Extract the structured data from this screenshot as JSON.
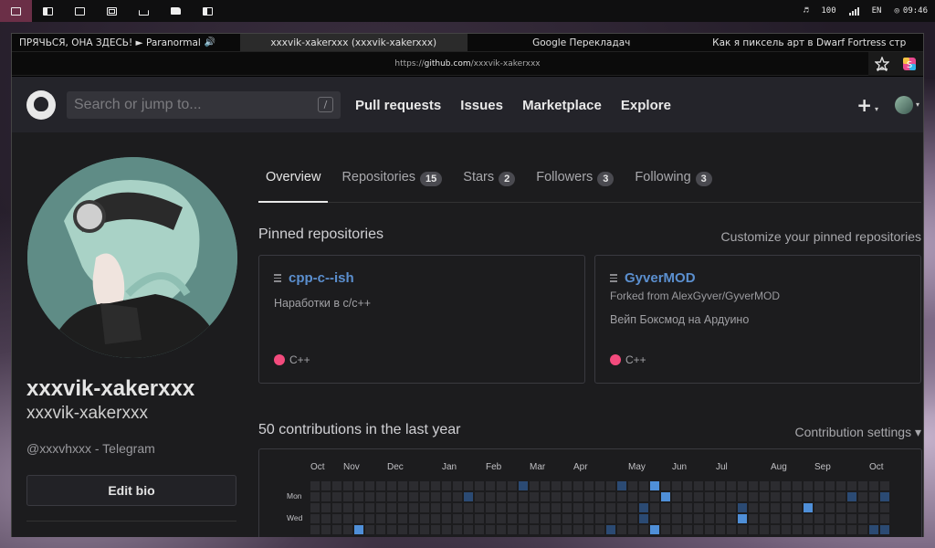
{
  "system_bar": {
    "workspaces": [
      "monitor-icon",
      "window-icon",
      "terminal-icon",
      "film-icon",
      "trash-icon",
      "folder-icon",
      "grid-icon"
    ],
    "volume": "100",
    "language": "EN",
    "time": "09:46"
  },
  "browser": {
    "tabs": [
      {
        "label": "ПРЯЧЬСЯ, ОНА ЗДЕСЬ! ► Paranormal",
        "audio": "🔊",
        "active": false
      },
      {
        "label": "xxxvik-xakerxxx (xxxvik-xakerxxx)",
        "active": true
      },
      {
        "label": "Google Переклaдач",
        "active": false
      },
      {
        "label": "Как я пиксель арт в Dwarf Fortress стр",
        "active": false
      }
    ],
    "url_prefix": "https://",
    "url_host": "github.com",
    "url_path": "/xxxvik-xakerxxx"
  },
  "header": {
    "search_placeholder": "Search or jump to...",
    "slash": "/",
    "nav": [
      "Pull requests",
      "Issues",
      "Marketplace",
      "Explore"
    ],
    "plus": "+",
    "caret": "▾"
  },
  "profile": {
    "name": "xxxvik-xakerxxx",
    "login": "xxxvik-xakerxxx",
    "bio": "@xxxvhxxx - Telegram",
    "edit_bio": "Edit bio"
  },
  "tabs": [
    {
      "label": "Overview",
      "count": null,
      "active": true
    },
    {
      "label": "Repositories",
      "count": "15",
      "active": false
    },
    {
      "label": "Stars",
      "count": "2",
      "active": false
    },
    {
      "label": "Followers",
      "count": "3",
      "active": false
    },
    {
      "label": "Following",
      "count": "3",
      "active": false
    }
  ],
  "pinned": {
    "title": "Pinned repositories",
    "customize": "Customize your pinned repositories",
    "repos": [
      {
        "name": "cpp-c--ish",
        "fork": "",
        "description": "Наработки в с/с++",
        "language": "C++",
        "lang_color": "#f34b7d"
      },
      {
        "name": "GyverMOD",
        "fork": "Forked from AlexGyver/GyverMOD",
        "description": "Вейп Боксмод на Ардуино",
        "language": "C++",
        "lang_color": "#f34b7d"
      }
    ]
  },
  "contributions": {
    "title": "50 contributions in the last year",
    "settings": "Contribution settings ▾",
    "months": [
      "Oct",
      "Nov",
      "Dec",
      "Jan",
      "Feb",
      "Mar",
      "Apr",
      "May",
      "Jun",
      "Jul",
      "Aug",
      "Sep",
      "Oct"
    ],
    "days": [
      "Mon",
      "Wed"
    ]
  },
  "colors": {
    "accent_link": "#5b8fcf",
    "cell_empty": "#2c2c30",
    "cell_l1": "#2b4a73",
    "cell_l2": "#3a6fb0",
    "cell_l3": "#4f8fd8"
  }
}
